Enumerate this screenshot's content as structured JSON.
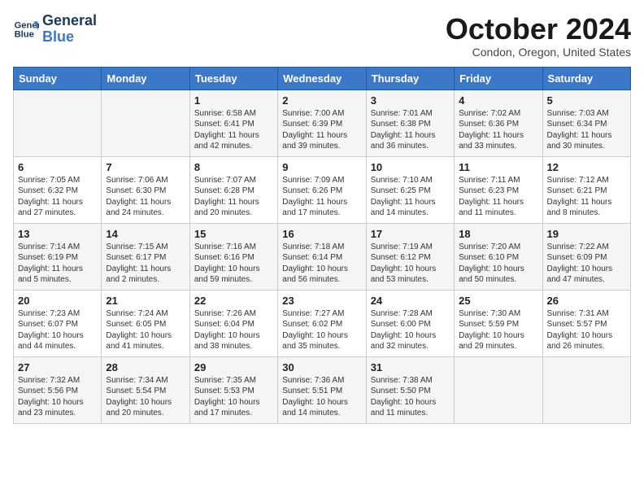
{
  "header": {
    "logo_line1": "General",
    "logo_line2": "Blue",
    "month": "October 2024",
    "location": "Condon, Oregon, United States"
  },
  "days_of_week": [
    "Sunday",
    "Monday",
    "Tuesday",
    "Wednesday",
    "Thursday",
    "Friday",
    "Saturday"
  ],
  "weeks": [
    [
      {
        "day": "",
        "text": ""
      },
      {
        "day": "",
        "text": ""
      },
      {
        "day": "1",
        "text": "Sunrise: 6:58 AM\nSunset: 6:41 PM\nDaylight: 11 hours and 42 minutes."
      },
      {
        "day": "2",
        "text": "Sunrise: 7:00 AM\nSunset: 6:39 PM\nDaylight: 11 hours and 39 minutes."
      },
      {
        "day": "3",
        "text": "Sunrise: 7:01 AM\nSunset: 6:38 PM\nDaylight: 11 hours and 36 minutes."
      },
      {
        "day": "4",
        "text": "Sunrise: 7:02 AM\nSunset: 6:36 PM\nDaylight: 11 hours and 33 minutes."
      },
      {
        "day": "5",
        "text": "Sunrise: 7:03 AM\nSunset: 6:34 PM\nDaylight: 11 hours and 30 minutes."
      }
    ],
    [
      {
        "day": "6",
        "text": "Sunrise: 7:05 AM\nSunset: 6:32 PM\nDaylight: 11 hours and 27 minutes."
      },
      {
        "day": "7",
        "text": "Sunrise: 7:06 AM\nSunset: 6:30 PM\nDaylight: 11 hours and 24 minutes."
      },
      {
        "day": "8",
        "text": "Sunrise: 7:07 AM\nSunset: 6:28 PM\nDaylight: 11 hours and 20 minutes."
      },
      {
        "day": "9",
        "text": "Sunrise: 7:09 AM\nSunset: 6:26 PM\nDaylight: 11 hours and 17 minutes."
      },
      {
        "day": "10",
        "text": "Sunrise: 7:10 AM\nSunset: 6:25 PM\nDaylight: 11 hours and 14 minutes."
      },
      {
        "day": "11",
        "text": "Sunrise: 7:11 AM\nSunset: 6:23 PM\nDaylight: 11 hours and 11 minutes."
      },
      {
        "day": "12",
        "text": "Sunrise: 7:12 AM\nSunset: 6:21 PM\nDaylight: 11 hours and 8 minutes."
      }
    ],
    [
      {
        "day": "13",
        "text": "Sunrise: 7:14 AM\nSunset: 6:19 PM\nDaylight: 11 hours and 5 minutes."
      },
      {
        "day": "14",
        "text": "Sunrise: 7:15 AM\nSunset: 6:17 PM\nDaylight: 11 hours and 2 minutes."
      },
      {
        "day": "15",
        "text": "Sunrise: 7:16 AM\nSunset: 6:16 PM\nDaylight: 10 hours and 59 minutes."
      },
      {
        "day": "16",
        "text": "Sunrise: 7:18 AM\nSunset: 6:14 PM\nDaylight: 10 hours and 56 minutes."
      },
      {
        "day": "17",
        "text": "Sunrise: 7:19 AM\nSunset: 6:12 PM\nDaylight: 10 hours and 53 minutes."
      },
      {
        "day": "18",
        "text": "Sunrise: 7:20 AM\nSunset: 6:10 PM\nDaylight: 10 hours and 50 minutes."
      },
      {
        "day": "19",
        "text": "Sunrise: 7:22 AM\nSunset: 6:09 PM\nDaylight: 10 hours and 47 minutes."
      }
    ],
    [
      {
        "day": "20",
        "text": "Sunrise: 7:23 AM\nSunset: 6:07 PM\nDaylight: 10 hours and 44 minutes."
      },
      {
        "day": "21",
        "text": "Sunrise: 7:24 AM\nSunset: 6:05 PM\nDaylight: 10 hours and 41 minutes."
      },
      {
        "day": "22",
        "text": "Sunrise: 7:26 AM\nSunset: 6:04 PM\nDaylight: 10 hours and 38 minutes."
      },
      {
        "day": "23",
        "text": "Sunrise: 7:27 AM\nSunset: 6:02 PM\nDaylight: 10 hours and 35 minutes."
      },
      {
        "day": "24",
        "text": "Sunrise: 7:28 AM\nSunset: 6:00 PM\nDaylight: 10 hours and 32 minutes."
      },
      {
        "day": "25",
        "text": "Sunrise: 7:30 AM\nSunset: 5:59 PM\nDaylight: 10 hours and 29 minutes."
      },
      {
        "day": "26",
        "text": "Sunrise: 7:31 AM\nSunset: 5:57 PM\nDaylight: 10 hours and 26 minutes."
      }
    ],
    [
      {
        "day": "27",
        "text": "Sunrise: 7:32 AM\nSunset: 5:56 PM\nDaylight: 10 hours and 23 minutes."
      },
      {
        "day": "28",
        "text": "Sunrise: 7:34 AM\nSunset: 5:54 PM\nDaylight: 10 hours and 20 minutes."
      },
      {
        "day": "29",
        "text": "Sunrise: 7:35 AM\nSunset: 5:53 PM\nDaylight: 10 hours and 17 minutes."
      },
      {
        "day": "30",
        "text": "Sunrise: 7:36 AM\nSunset: 5:51 PM\nDaylight: 10 hours and 14 minutes."
      },
      {
        "day": "31",
        "text": "Sunrise: 7:38 AM\nSunset: 5:50 PM\nDaylight: 10 hours and 11 minutes."
      },
      {
        "day": "",
        "text": ""
      },
      {
        "day": "",
        "text": ""
      }
    ]
  ]
}
